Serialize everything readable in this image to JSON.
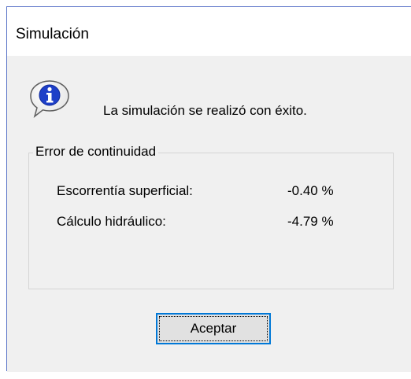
{
  "window": {
    "title": "Simulación"
  },
  "dialog": {
    "icon": "info-icon",
    "message": "La simulación se realizó con éxito.",
    "group": {
      "label": "Error de continuidad",
      "rows": [
        {
          "label": "Escorrentía superficial:",
          "value": "-0.40 %"
        },
        {
          "label": "Cálculo hidráulico:",
          "value": "-4.79 %"
        }
      ]
    },
    "ok_label": "Aceptar"
  },
  "colors": {
    "accent": "#0078d7",
    "window_border": "#5a74c8",
    "face": "#f0f0f0"
  }
}
